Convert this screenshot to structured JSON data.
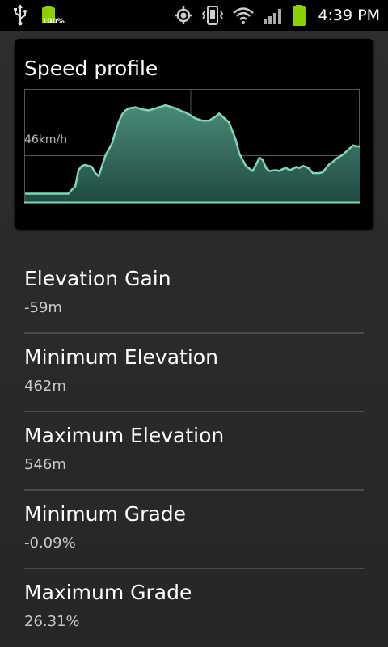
{
  "status_bar": {
    "battery_left_text": "100%",
    "time": "4:39 PM",
    "icons": [
      "usb-icon",
      "battery-icon",
      "gps-icon",
      "vibrate-icon",
      "wifi-icon",
      "signal-icon",
      "battery-icon"
    ],
    "colors": {
      "battery": "#8cd000"
    }
  },
  "speed_card": {
    "title": "Speed profile",
    "reference_label": "46km/h"
  },
  "chart_data": {
    "type": "area",
    "title": "Speed profile",
    "ylabel": "",
    "xlabel": "",
    "grid": true,
    "reference_line": {
      "label": "46km/h",
      "value": 46
    },
    "ylim": [
      0,
      110
    ],
    "xlim": [
      0,
      100
    ],
    "x": [
      0,
      10,
      13,
      14,
      15,
      16,
      17,
      18,
      20,
      21,
      22,
      24,
      26,
      27,
      28,
      29,
      30,
      31,
      33,
      35,
      37,
      39,
      40,
      41,
      42,
      45,
      47,
      48,
      49,
      51,
      53,
      55,
      56,
      57,
      58,
      61,
      63,
      64,
      66,
      68,
      69,
      70,
      71,
      72,
      73,
      75,
      76,
      77,
      78,
      79,
      80,
      81,
      82,
      83,
      84,
      85,
      86,
      88,
      89,
      90,
      91,
      92,
      93,
      95,
      97,
      98,
      99,
      100
    ],
    "values": [
      9,
      9,
      9,
      13,
      16,
      32,
      36,
      37,
      35,
      29,
      26,
      46,
      58,
      69,
      79,
      86,
      90,
      92,
      93,
      91,
      90,
      92,
      93,
      94,
      95,
      92,
      89,
      88,
      86,
      82,
      80,
      80,
      82,
      84,
      87,
      78,
      61,
      48,
      36,
      31,
      37,
      44,
      42,
      34,
      31,
      32,
      31,
      33,
      34,
      32,
      33,
      35,
      34,
      36,
      35,
      33,
      29,
      29,
      30,
      34,
      38,
      40,
      43,
      47,
      53,
      56,
      55,
      55
    ],
    "colors": {
      "line": "#7fd6b8",
      "fill_top": "#4a8a78",
      "fill_bottom": "#1f4a42"
    }
  },
  "stats": [
    {
      "label": "Elevation Gain",
      "value": "-59m"
    },
    {
      "label": "Minimum Elevation",
      "value": "462m"
    },
    {
      "label": "Maximum Elevation",
      "value": "546m"
    },
    {
      "label": "Minimum Grade",
      "value": "-0.09%"
    },
    {
      "label": "Maximum Grade",
      "value": "26.31%"
    }
  ]
}
